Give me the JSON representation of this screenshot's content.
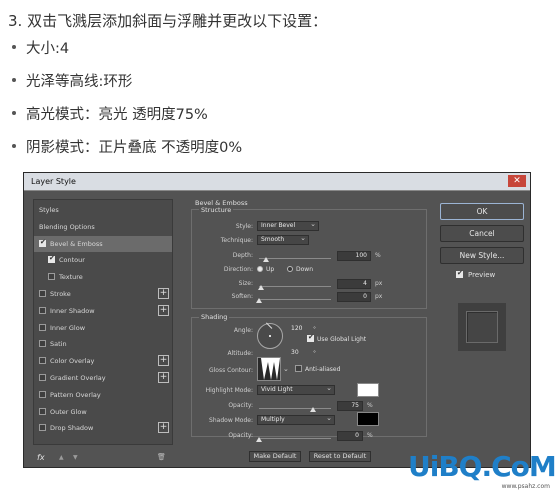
{
  "intro": {
    "heading": "3. 双击飞溅层添加斜面与浮雕并更改以下设置：",
    "bullets": [
      "大小:4",
      "光泽等高线:环形",
      "高光模式：亮光    透明度75%",
      "阴影模式：正片叠底 不透明度0%"
    ]
  },
  "dialog": {
    "title": "Layer Style",
    "close_glyph": "✕",
    "left_items": [
      {
        "label": "Styles",
        "checkbox": false,
        "checked": false,
        "plus": false,
        "selected": false,
        "indent": 0
      },
      {
        "label": "Blending Options",
        "checkbox": false,
        "checked": false,
        "plus": false,
        "selected": false,
        "indent": 0
      },
      {
        "label": "Bevel & Emboss",
        "checkbox": true,
        "checked": true,
        "plus": false,
        "selected": true,
        "indent": 0
      },
      {
        "label": "Contour",
        "checkbox": true,
        "checked": true,
        "plus": false,
        "selected": false,
        "indent": 1
      },
      {
        "label": "Texture",
        "checkbox": true,
        "checked": false,
        "plus": false,
        "selected": false,
        "indent": 1
      },
      {
        "label": "Stroke",
        "checkbox": true,
        "checked": false,
        "plus": true,
        "selected": false,
        "indent": 0
      },
      {
        "label": "Inner Shadow",
        "checkbox": true,
        "checked": false,
        "plus": true,
        "selected": false,
        "indent": 0
      },
      {
        "label": "Inner Glow",
        "checkbox": true,
        "checked": false,
        "plus": false,
        "selected": false,
        "indent": 0
      },
      {
        "label": "Satin",
        "checkbox": true,
        "checked": false,
        "plus": false,
        "selected": false,
        "indent": 0
      },
      {
        "label": "Color Overlay",
        "checkbox": true,
        "checked": false,
        "plus": true,
        "selected": false,
        "indent": 0
      },
      {
        "label": "Gradient Overlay",
        "checkbox": true,
        "checked": false,
        "plus": true,
        "selected": false,
        "indent": 0
      },
      {
        "label": "Pattern Overlay",
        "checkbox": true,
        "checked": false,
        "plus": false,
        "selected": false,
        "indent": 0
      },
      {
        "label": "Outer Glow",
        "checkbox": true,
        "checked": false,
        "plus": false,
        "selected": false,
        "indent": 0
      },
      {
        "label": "Drop Shadow",
        "checkbox": true,
        "checked": false,
        "plus": true,
        "selected": false,
        "indent": 0
      }
    ],
    "bottom_icons": {
      "fx": "fx",
      "up": "▲",
      "down": "▼",
      "trash": "🗑"
    },
    "bevel": {
      "group_title": "Bevel & Emboss",
      "structure_title": "Structure",
      "style_label": "Style:",
      "style_value": "Inner Bevel",
      "technique_label": "Technique:",
      "technique_value": "Smooth",
      "depth_label": "Depth:",
      "depth_value": "100",
      "depth_unit": "%",
      "depth_level": 0.1,
      "direction_label": "Direction:",
      "dir_up": "Up",
      "dir_down": "Down",
      "direction_up_selected": true,
      "size_label": "Size:",
      "size_value": "4",
      "size_unit": "px",
      "size_level": 0.03,
      "soften_label": "Soften:",
      "soften_value": "0",
      "soften_unit": "px",
      "soften_level": 0.0
    },
    "shading": {
      "title": "Shading",
      "angle_label": "Angle:",
      "angle_value": "120",
      "angle_unit": "°",
      "global_light_label": "Use Global Light",
      "global_light_checked": true,
      "altitude_label": "Altitude:",
      "altitude_value": "30",
      "altitude_unit": "°",
      "gloss_contour_label": "Gloss Contour:",
      "anti_aliased_label": "Anti-aliased",
      "anti_aliased_checked": false,
      "highlight_mode_label": "Highlight Mode:",
      "highlight_mode_value": "Vivid Light",
      "highlight_color": "#ffffff",
      "highlight_opacity_label": "Opacity:",
      "highlight_opacity_value": "75",
      "highlight_opacity_unit": "%",
      "highlight_opacity_level": 0.75,
      "shadow_mode_label": "Shadow Mode:",
      "shadow_mode_value": "Multiply",
      "shadow_color": "#000000",
      "shadow_opacity_label": "Opacity:",
      "shadow_opacity_value": "0",
      "shadow_opacity_unit": "%",
      "shadow_opacity_level": 0.0
    },
    "make_default": "Make Default",
    "reset_default": "Reset to Default",
    "ok_label": "OK",
    "cancel_label": "Cancel",
    "new_style_label": "New Style...",
    "preview_label": "Preview",
    "preview_checked": true
  },
  "watermark": {
    "text": "UiBQ.CoM",
    "sub": "www.psahz.com"
  }
}
